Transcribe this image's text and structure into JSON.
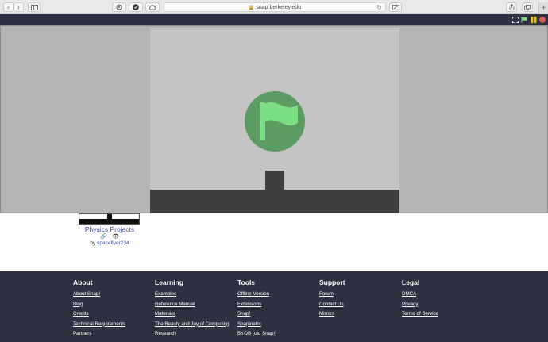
{
  "browser": {
    "url": "snap.berkeley.edu",
    "back_icon": "chevron-left-icon",
    "forward_icon": "chevron-right-icon",
    "sidebar_icon": "sidebar-icon",
    "reload_icon": "reload-icon",
    "new_tab_label": "+"
  },
  "stage": {
    "background_color": "#c4c4c4",
    "ground_color": "#404040",
    "flag_color": "#7ddf84",
    "flag_circle_color": "#5c9c62"
  },
  "project": {
    "title": "Physics Projects",
    "by_label": "by",
    "author": "spaceflyer234"
  },
  "footer": {
    "columns": [
      {
        "heading": "About",
        "links": [
          "About Snap!",
          "Blog",
          "Credits",
          "Technical Requirements",
          "Partners"
        ]
      },
      {
        "heading": "Learning",
        "links": [
          "Examples",
          "Reference Manual",
          "Materials",
          "The Beauty and Joy of Computing",
          "Research"
        ]
      },
      {
        "heading": "Tools",
        "links": [
          "Offline Version",
          "Extensions",
          "Snap!",
          "Snapinator",
          "BYOB (old Snap!)"
        ]
      },
      {
        "heading": "Support",
        "links": [
          "Forum",
          "Contact Us",
          "Mirrors"
        ]
      },
      {
        "heading": "Legal",
        "links": [
          "DMCA",
          "Privacy",
          "Terms of Service"
        ]
      }
    ]
  }
}
